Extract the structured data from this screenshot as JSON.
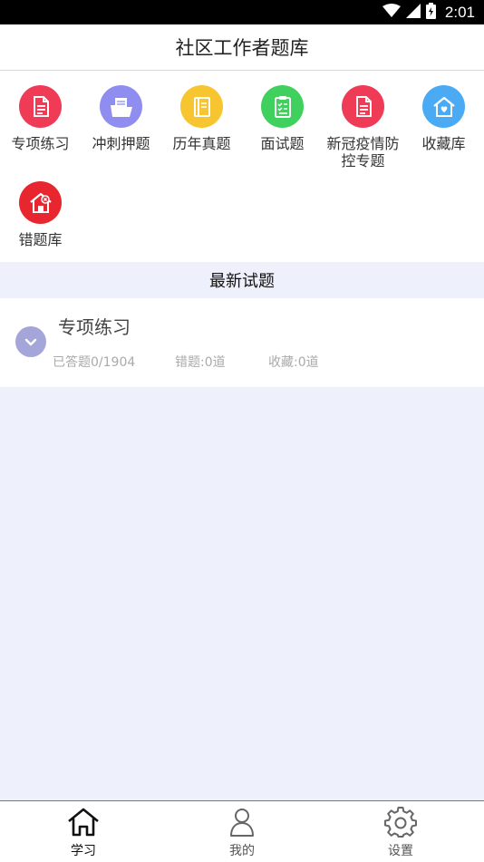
{
  "status_bar": {
    "time": "2:01"
  },
  "header": {
    "title": "社区工作者题库"
  },
  "categories": [
    {
      "label": "专项练习",
      "icon": "document-icon",
      "color": "#ef3b55"
    },
    {
      "label": "冲刺押题",
      "icon": "folder-icon",
      "color": "#8f8ef0"
    },
    {
      "label": "历年真题",
      "icon": "book-icon",
      "color": "#f7c530"
    },
    {
      "label": "面试题",
      "icon": "checklist-icon",
      "color": "#3fd05d"
    },
    {
      "label": "新冠疫情防控专题",
      "icon": "document-icon",
      "color": "#ef3b55"
    },
    {
      "label": "收藏库",
      "icon": "home-heart-icon",
      "color": "#4aabf4"
    },
    {
      "label": "错题库",
      "icon": "home-x-icon",
      "color": "#e8262f"
    }
  ],
  "section": {
    "title": "最新试题"
  },
  "exam": {
    "title": "专项练习",
    "answered": "已答题0/1904",
    "wrong": "错题:0道",
    "favorites": "收藏:0道"
  },
  "nav": [
    {
      "label": "学习",
      "icon": "home-icon",
      "active": true
    },
    {
      "label": "我的",
      "icon": "person-icon",
      "active": false
    },
    {
      "label": "设置",
      "icon": "gear-icon",
      "active": false
    }
  ],
  "colors": {
    "accent": "#18a58a",
    "section_bg": "#eef1fb",
    "expand_button": "#a4a6d9"
  }
}
